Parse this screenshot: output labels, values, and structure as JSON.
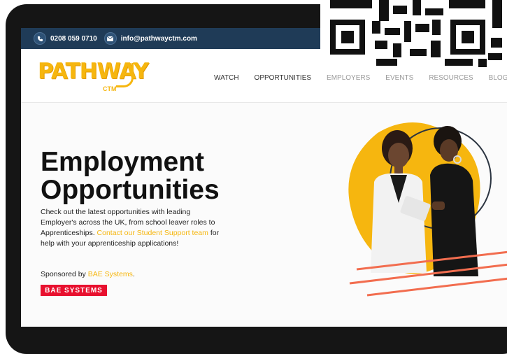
{
  "topbar": {
    "phone": "0208 059 0710",
    "email": "info@pathwayctm.com",
    "phone_icon": "phone-icon",
    "email_icon": "mail-icon"
  },
  "header": {
    "logo_text": "PATHWAY",
    "logo_sub": "CTM",
    "nav": [
      "WATCH",
      "OPPORTUNITIES",
      "EMPLOYERS",
      "EVENTS",
      "RESOURCES",
      "BLOG"
    ]
  },
  "hero": {
    "title_line1": "Employment",
    "title_line2": "Opportunities",
    "body_part1": "Check out the latest opportunities with leading Employer's across the UK, from school leaver roles to Apprenticeships. ",
    "body_link": "Contact our Student Support team",
    "body_part2": " for help with your apprenticeship applications!",
    "sponsor_prefix": "Sponsored by ",
    "sponsor_link": "BAE Systems",
    "sponsor_suffix": ".",
    "badge": "BAE SYSTEMS"
  },
  "colors": {
    "brand": "#f6b60f",
    "topbar": "#1f3b57",
    "badge": "#e8102e",
    "accent_lines": "#f26d4f"
  }
}
